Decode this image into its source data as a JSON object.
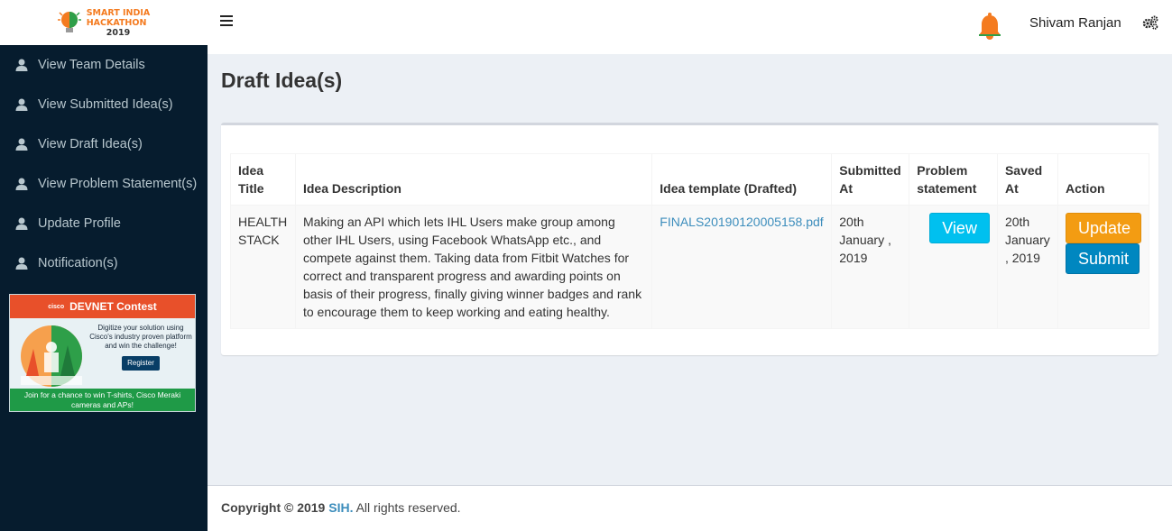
{
  "logo": {
    "line1": "SMART INDIA",
    "line2": "HACKATHON",
    "line3": "2019"
  },
  "sidebar": {
    "items": [
      {
        "label": "View Team Details",
        "icon": "user-icon"
      },
      {
        "label": "View Submitted Idea(s)",
        "icon": "user-icon"
      },
      {
        "label": "View Draft Idea(s)",
        "icon": "user-icon"
      },
      {
        "label": "View Problem Statement(s)",
        "icon": "user-icon"
      },
      {
        "label": "Update Profile",
        "icon": "user-icon"
      },
      {
        "label": "Notification(s)",
        "icon": "user-icon"
      }
    ],
    "banner": {
      "brand": "cisco",
      "title": "DEVNET Contest",
      "copy": "Digitize your solution using Cisco's industry proven platform and win the challenge!",
      "register": "Register",
      "footer": "Join for a chance to win T-shirts, Cisco Meraki cameras and APs!"
    }
  },
  "header": {
    "username": "Shivam Ranjan"
  },
  "main": {
    "title": "Draft Idea(s)",
    "table": {
      "headers": [
        "Idea Title",
        "Idea Description",
        "Idea template (Drafted)",
        "Submitted At",
        "Problem statement",
        "Saved At",
        "Action"
      ],
      "rows": [
        {
          "title": "HEALTH STACK",
          "description": "Making an API which lets IHL Users make group among other IHL Users, using Facebook WhatsApp etc., and compete against them. Taking data from Fitbit Watches for correct and transparent progress and awarding points on basis of their progress, finally giving winner badges and rank to encourage them to keep working and eating healthy.",
          "template": "FINALS20190120005158.pdf",
          "submitted_at": "20th January , 2019",
          "problem_button": "View",
          "saved_at": "20th January , 2019",
          "update_button": "Update",
          "submit_button": "Submit"
        }
      ]
    }
  },
  "footer": {
    "copyright": "Copyright © 2019",
    "brand": "SIH.",
    "rest": "All rights reserved."
  },
  "colors": {
    "sidebar_bg": "#061c2e",
    "content_bg": "#ecf0f5",
    "link": "#3c8dbc",
    "view_button": "#00c0ef",
    "update_button": "#f39c12",
    "submit_button": "#0087c0",
    "bell": "#f47b20"
  }
}
